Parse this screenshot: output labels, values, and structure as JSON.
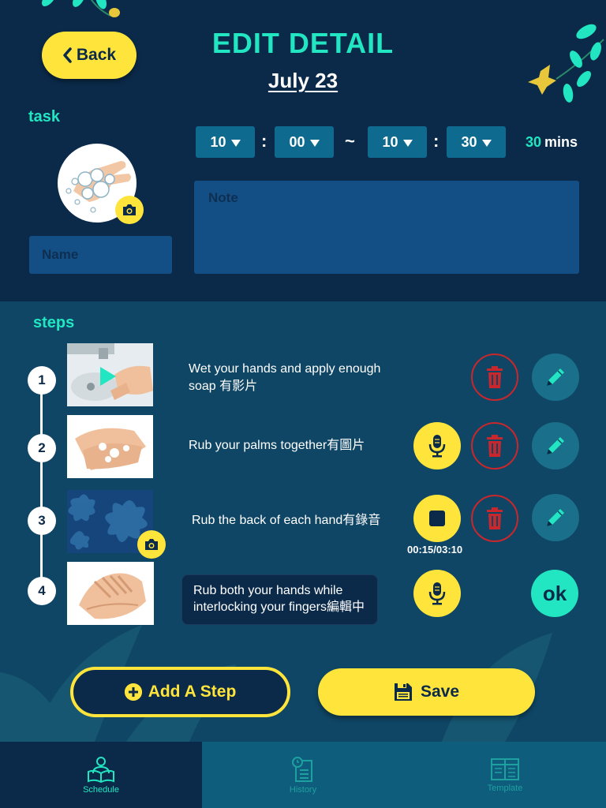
{
  "header": {
    "back_label": "Back",
    "title": "EDIT DETAIL",
    "date": "July 23"
  },
  "task": {
    "section_label": "task",
    "name_placeholder": "Name",
    "note_placeholder": "Note",
    "time": {
      "start_hour": "10",
      "start_minute": "00",
      "range_separator": "~",
      "colon": ":",
      "end_hour": "10",
      "end_minute": "30",
      "duration_value": "30",
      "duration_unit": "mins"
    }
  },
  "steps": {
    "section_label": "steps",
    "items": [
      {
        "number": "1",
        "text_line1": "Wet your hands and apply enough",
        "text_line2": "soap 有影片"
      },
      {
        "number": "2",
        "text_line1": "Rub your palms together有圖片"
      },
      {
        "number": "3",
        "text_line1": "Rub the back of each hand有錄音",
        "recording_time": "00:15/03:10"
      },
      {
        "number": "4",
        "text_line1": "Rub both your hands while",
        "text_line2": "interlocking your fingers編輯中",
        "ok_label": "ok"
      }
    ]
  },
  "actions": {
    "add_step_label": "Add A Step",
    "save_label": "Save"
  },
  "tabbar": {
    "tabs": [
      {
        "label": "Schedule",
        "icon": "schedule-icon",
        "active": true
      },
      {
        "label": "History",
        "icon": "history-icon",
        "active": false
      },
      {
        "label": "Template",
        "icon": "template-icon",
        "active": false
      }
    ]
  },
  "colors": {
    "navy": "#0b2a4a",
    "teal_panel": "#0f4665",
    "accent_yellow": "#ffe53b",
    "accent_mint": "#21e6c1",
    "delete_red": "#c9272c"
  }
}
